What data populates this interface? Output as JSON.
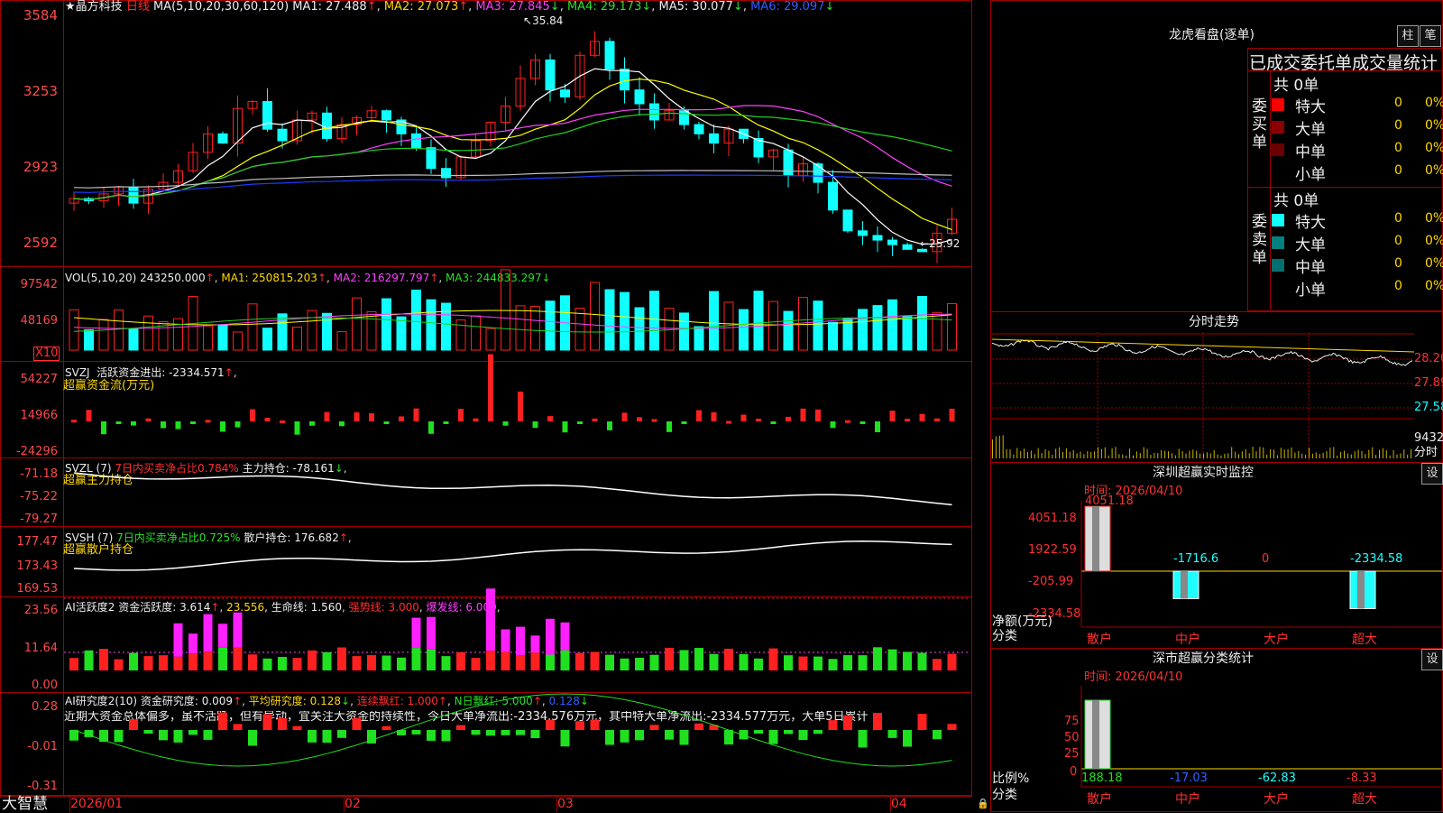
{
  "app": {
    "brand": "大智慧",
    "lock_icon": "lock-icon"
  },
  "stock": {
    "name": "晶方科技",
    "period": "日线",
    "star": "★"
  },
  "main_chart": {
    "ma_title": "MA(5,10,20,30,60,120)",
    "ma1": "MA1: 27.488",
    "ma2": "MA2: 27.073",
    "ma3": "MA3: 27.845",
    "ma4": "MA4: 29.173",
    "ma5": "MA5: 30.077",
    "ma6": "MA6: 29.097",
    "y_ticks": [
      "3584",
      "3253",
      "2923",
      "2592"
    ],
    "high_label": "35.84",
    "low_label": "25.92",
    "colors": {
      "up": "#ff2020",
      "down": "#10ffff",
      "ma1": "#ffffff",
      "ma2": "#ffff00",
      "ma3": "#ff40ff",
      "ma4": "#20d020",
      "ma5": "#c0c0c0",
      "ma6": "#1a3cff"
    }
  },
  "vol_chart": {
    "title": "VOL(5,10,20)",
    "value": "243250.000",
    "ma1": "MA1: 250815.203",
    "ma2": "MA2: 216297.797",
    "ma3": "MA3: 244833.297",
    "y_ticks": [
      "97542",
      "48169"
    ],
    "unit": "X10"
  },
  "svzj": {
    "title": "SVZJ",
    "text": "活跃资金进出: -2334.571",
    "subtitle": "超赢资金流(万元)",
    "y_ticks": [
      "54227",
      "14966",
      "-24296"
    ]
  },
  "svzl": {
    "title": "SVZL (7)",
    "ratio": "7日内买卖净占比0.784%",
    "hold": "主力持仓: -78.161",
    "subtitle": "超赢主力持仓",
    "y_ticks": [
      "-71.18",
      "-75.22",
      "-79.27"
    ]
  },
  "svsh": {
    "title": "SVSH (7)",
    "ratio": "7日内买卖净占比0.725%",
    "hold": "散户持仓: 176.682",
    "subtitle": "超赢散户持仓",
    "y_ticks": [
      "177.47",
      "173.43",
      "169.53"
    ]
  },
  "ai_active": {
    "title": "AI活跃度2",
    "active": "资金活跃度: 3.614",
    "v2": "23.556",
    "life": "生命线: 1.560",
    "strong": "强势线: 3.000",
    "burst": "爆发线: 6.000",
    "y_ticks": [
      "23.56",
      "11.64",
      "0.00"
    ]
  },
  "ai_research": {
    "title": "AI研究度2(10)",
    "research": "资金研究度: 0.009",
    "avg": "平均研究度: 0.128",
    "cont": "连续飘红: 1.000",
    "nday": "N日飘红: 5.000",
    "v": "0.128",
    "comment": "近期大资金总体偏多，虽不活跃，但有异动，宜关注大资金的持续性，今日大单净流出:-2334.576万元，其中特大单净流出:-2334.577万元，大单5日累计",
    "y_ticks": [
      "0.28",
      "-0.01",
      "-0.31"
    ]
  },
  "x_axis": [
    "2026/01",
    "02",
    "03",
    "04"
  ],
  "dragon": {
    "title": "龙虎看盘(逐单)",
    "btn1": "柱",
    "btn2": "笔",
    "header": "已成交委托单成交量统计",
    "buy_total": "共 0单",
    "sell_total": "共 0单",
    "buy_label": "委买单",
    "sell_label": "委卖单",
    "rows": [
      {
        "label": "特大",
        "count": "0",
        "pct": "0%"
      },
      {
        "label": "大单",
        "count": "0",
        "pct": "0%"
      },
      {
        "label": "中单",
        "count": "0",
        "pct": "0%"
      },
      {
        "label": "小单",
        "count": "0",
        "pct": "0%"
      }
    ],
    "buy_colors": [
      "#ff0000",
      "#8a0000",
      "#6a0000"
    ],
    "sell_colors": [
      "#10ffff",
      "#008080",
      "#007070"
    ]
  },
  "intraday": {
    "title": "分时走势",
    "p1": "28.20",
    "p2": "27.89",
    "p3": "27.58",
    "vol": "9432",
    "vol_label": "分时"
  },
  "sz_monitor": {
    "title": "深圳超赢实时监控",
    "btn": "设",
    "time": "时间: 2026/04/10",
    "y_ticks": [
      "4051.18",
      "1922.59",
      "-205.99",
      "-2334.58"
    ],
    "y_label": "净额(万元)",
    "x_label": "分类",
    "categories": [
      "散户",
      "中户",
      "大户",
      "超大"
    ],
    "values_text": [
      "4051.18",
      "-1716.6",
      "0",
      "-2334.58"
    ],
    "values": [
      4051.18,
      -1716.6,
      0,
      -2334.58
    ]
  },
  "sz_class": {
    "title": "深市超赢分类统计",
    "btn": "设",
    "time": "时间: 2026/04/10",
    "y_ticks": [
      "75",
      "50",
      "25",
      "0"
    ],
    "y_label": "比例%",
    "x_label": "分类",
    "categories": [
      "散户",
      "中户",
      "大户",
      "超大"
    ],
    "values_text": [
      "188.18",
      "-17.03",
      "-62.83",
      "-8.33"
    ],
    "values": [
      188.18,
      -17.03,
      -62.83,
      -8.33
    ]
  }
}
